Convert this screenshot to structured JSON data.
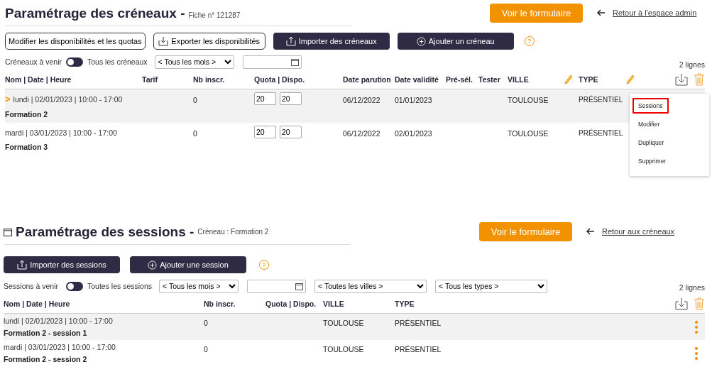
{
  "slots": {
    "title": "Paramétrage des créneaux -",
    "subtitle": "Fiche n° 121287",
    "form_button": "Voir le formulaire",
    "back_link": "Retour à l'espace admin",
    "actions": [
      {
        "label": "Modifier les disponibilités et les quotas",
        "kind": "outline"
      },
      {
        "label": "Exporter les disponibilités",
        "kind": "outline-export"
      },
      {
        "label": "Importer des créneaux",
        "kind": "dark-import"
      },
      {
        "label": "Ajouter un créneau",
        "kind": "dark-add"
      }
    ],
    "help": "?",
    "filters": {
      "left_label": "Créneaux à venir",
      "toggle_on": false,
      "right_label": "Tous les créneaux",
      "month": "< Tous les mois >"
    },
    "count": "2 lignes",
    "columns": [
      "Nom | Date | Heure",
      "Tarif",
      "Nb inscr.",
      "Quota | Dispo.",
      "Date parution",
      "Date validité",
      "Pré-sél.",
      "Tester",
      "VILLE",
      "TYPE"
    ],
    "rows": [
      {
        "selected": true,
        "marker": ">",
        "when": "lundi | 02/01/2023 | 10:00 - 17:00",
        "name": "Formation 2",
        "nb": "0",
        "quota": "20",
        "dispo": "20",
        "parution": "06/12/2022",
        "validite": "01/01/2023",
        "ville": "TOULOUSE",
        "type": "PRÉSENTIEL"
      },
      {
        "selected": false,
        "when": "mardi | 03/01/2023 | 10:00 - 17:00",
        "name": "Formation 3",
        "nb": "0",
        "quota": "20",
        "dispo": "20",
        "parution": "06/12/2022",
        "validite": "02/01/2023",
        "ville": "TOULOUSE",
        "type": "PRÉSENTIEL"
      }
    ],
    "menu": [
      {
        "label": "Sessions",
        "selected": true
      },
      {
        "label": "Modifier",
        "selected": false
      },
      {
        "label": "Dupliquer",
        "selected": false
      },
      {
        "label": "Supprimer",
        "selected": false
      }
    ]
  },
  "sessions": {
    "title": "Paramétrage des sessions -",
    "subtitle": "Créneau : Formation 2",
    "form_button": "Voir le formulaire",
    "back_link": "Retour aux créneaux",
    "actions": [
      {
        "label": "Importer des sessions",
        "kind": "dark-import"
      },
      {
        "label": "Ajouter une session",
        "kind": "dark-add"
      }
    ],
    "help": "?",
    "filters": {
      "left_label": "Sessions à venir",
      "toggle_on": false,
      "right_label": "Toutes les sessions",
      "month": "< Tous les mois >",
      "city": "< Toutes les villes >",
      "type": "< Tous les types >"
    },
    "count": "2 lignes",
    "columns": [
      "Nom | Date | Heure",
      "Nb inscr.",
      "Quota | Dispo.",
      "VILLE",
      "TYPE"
    ],
    "rows": [
      {
        "selected": true,
        "when": "lundi | 02/01/2023 | 10:00 - 17:00",
        "name": "Formation 2 - session 1",
        "nb": "0",
        "ville": "TOULOUSE",
        "type": "PRÉSENTIEL"
      },
      {
        "selected": false,
        "when": "mardi | 03/01/2023 | 10:00 - 17:00",
        "name": "Formation 2 - session 2",
        "nb": "0",
        "ville": "TOULOUSE",
        "type": "PRÉSENTIEL"
      }
    ]
  }
}
